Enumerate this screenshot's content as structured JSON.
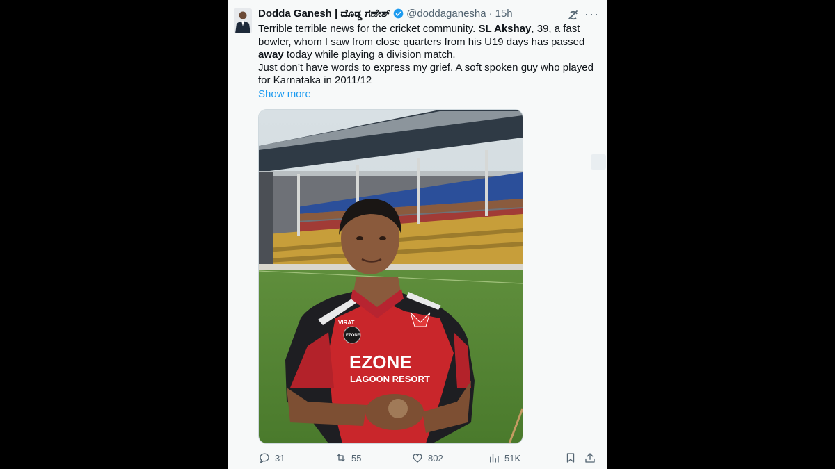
{
  "tweet": {
    "author_name": "Dodda Ganesh | ದೊಡ್ಡ ಗಣೇಶ್",
    "handle": "@doddaganesha",
    "separator": "·",
    "time": "15h",
    "text": {
      "p1": "Terrible terrible news for the cricket community. ",
      "p1_bold": "SL Akshay",
      "p2": ", 39, a fast bowler, whom I saw from close quarters from his U19 days has passed ",
      "p2_bold": "away",
      "p3": " today while playing a division match.",
      "p4": "Just don’t have words to express my grief. A soft spoken guy who played for Karnataka in 2011/12"
    },
    "show_more": "Show more",
    "media": {
      "jersey_brand": "EZONE",
      "jersey_sub": "LAGOON RESORT",
      "jersey_sponsor": "VIRAT",
      "jersey_badge": "EZONE"
    },
    "actions": {
      "replies": "31",
      "reposts": "55",
      "likes": "802",
      "views": "51K"
    }
  },
  "colors": {
    "accent": "#1d9bf0",
    "text": "#0f1419",
    "muted": "#536471",
    "card_bg": "#f7f9f9",
    "page_bg": "#000000"
  },
  "icons": [
    "verified-badge-icon",
    "grok-icon",
    "more-icon",
    "reply-icon",
    "repost-icon",
    "like-icon",
    "views-icon",
    "bookmark-icon",
    "share-icon"
  ]
}
